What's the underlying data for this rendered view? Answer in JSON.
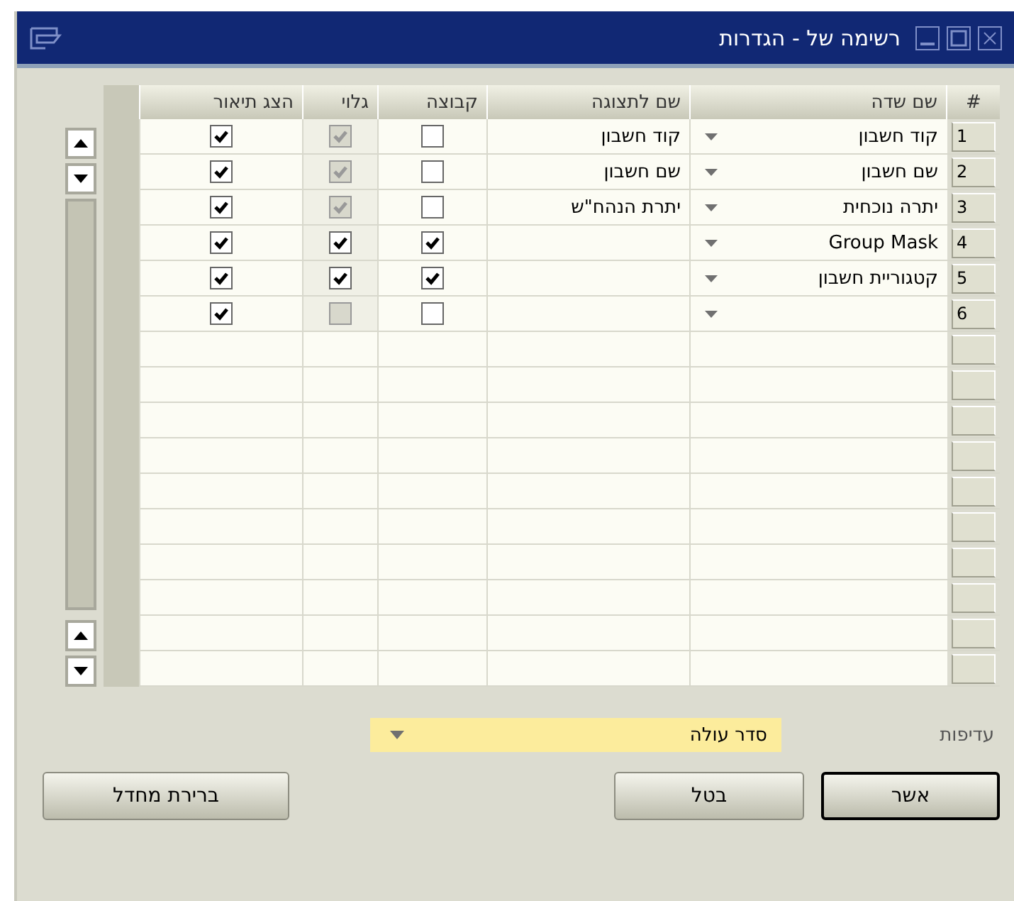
{
  "window": {
    "title": "רשימה של - הגדרות"
  },
  "table": {
    "columns": [
      "#",
      "שם שדה",
      "שם לתצוגה",
      "קבוצה",
      "גלוי",
      "הצג תיאור"
    ],
    "rows": [
      {
        "number": "1",
        "field_name": "קוד חשבון",
        "display_name": "קוד חשבון",
        "group": false,
        "visible": true,
        "visible_disabled": true,
        "show_description": true
      },
      {
        "number": "2",
        "field_name": "שם חשבון",
        "display_name": "שם חשבון",
        "group": false,
        "visible": true,
        "visible_disabled": true,
        "show_description": true
      },
      {
        "number": "3",
        "field_name": "יתרה נוכחית",
        "display_name": "יתרת הנהח\"ש",
        "group": false,
        "visible": true,
        "visible_disabled": true,
        "show_description": true
      },
      {
        "number": "4",
        "field_name": "Group Mask",
        "group": true,
        "visible": true,
        "visible_disabled": false,
        "show_description": true
      },
      {
        "number": "5",
        "field_name": "קטגוריית חשבון",
        "group": true,
        "visible": true,
        "visible_disabled": false,
        "show_description": true
      },
      {
        "number": "6",
        "group": false,
        "visible": false,
        "visible_disabled": true,
        "show_description": true
      }
    ]
  },
  "priority": {
    "label": "עדיפות",
    "value": "סדר עולה"
  },
  "buttons": [
    {
      "label": "אשר",
      "default": true
    },
    {
      "label": "בטל",
      "default": false
    },
    {
      "label": "ברירת מחדל",
      "default": false
    }
  ]
}
